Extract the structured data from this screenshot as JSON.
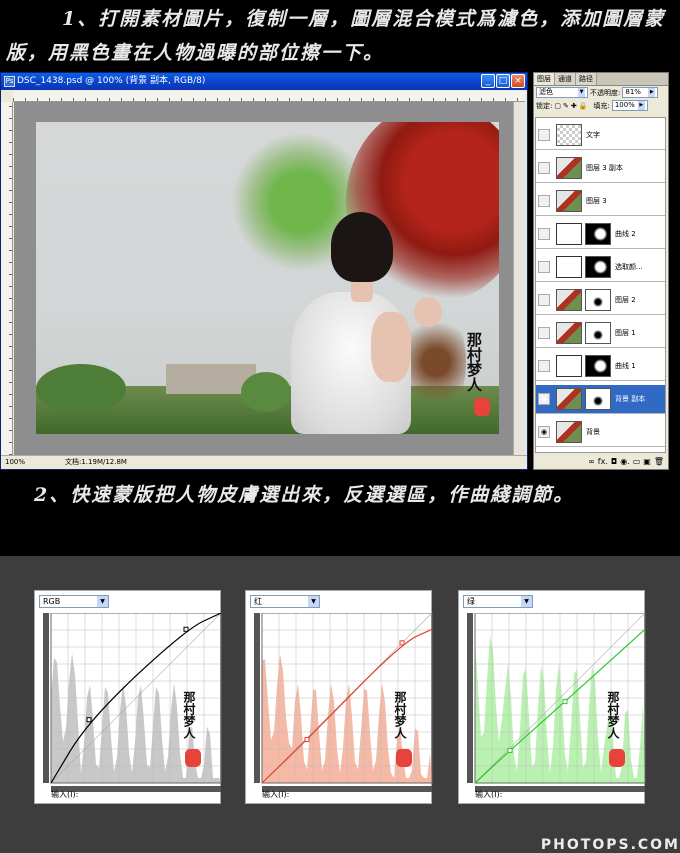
{
  "instructions": {
    "step1": "1、打開素材圖片，復制一層，圖層混合模式爲濾色，添加圖層蒙版，用黑色畫在人物過曝的部位擦一下。",
    "step2": "2、快速蒙版把人物皮膚選出來，反選選區，作曲綫調節。"
  },
  "document": {
    "title": "DSC_1438.psd @ 100% (背景 副本, RGB/8)",
    "zoom": "100%",
    "doc_size": "文档:1.19M/12.8M",
    "ps_icon": "Ps",
    "btn_min": "_",
    "btn_max": "□",
    "btn_close": "×",
    "calligraphy": "那村梦人"
  },
  "layers_panel": {
    "tabs": [
      "图层",
      "通道",
      "路径"
    ],
    "blend_mode": "滤色",
    "opacity_label": "不透明度:",
    "opacity_value": "81%",
    "lock_label": "锁定:",
    "fill_label": "填充:",
    "fill_value": "100%",
    "layers": [
      {
        "name": "文字",
        "thumb": "check",
        "mask": false,
        "visible": false,
        "selected": false
      },
      {
        "name": "图层 3 副本",
        "thumb": "photo",
        "mask": false,
        "visible": false,
        "selected": false
      },
      {
        "name": "图层 3",
        "thumb": "photo",
        "mask": false,
        "visible": false,
        "selected": false
      },
      {
        "name": "曲线 2",
        "thumb": "adj",
        "mask": true,
        "visible": false,
        "selected": false
      },
      {
        "name": "选取颜...",
        "thumb": "adj",
        "mask": true,
        "visible": false,
        "selected": false
      },
      {
        "name": "图层 2",
        "thumb": "photo",
        "mask": true,
        "visible": false,
        "selected": false
      },
      {
        "name": "图层 1",
        "thumb": "photo",
        "mask": true,
        "visible": false,
        "selected": false
      },
      {
        "name": "曲线 1",
        "thumb": "adj",
        "mask": true,
        "visible": false,
        "selected": false
      },
      {
        "name": "背景 副本",
        "thumb": "photo",
        "mask": true,
        "visible": true,
        "selected": true
      },
      {
        "name": "背景",
        "thumb": "photo",
        "mask": false,
        "visible": true,
        "selected": false
      }
    ],
    "footer_icons": [
      "∞",
      "fx.",
      "◘",
      "◉.",
      "▭",
      "▣",
      "🗑"
    ]
  },
  "curves": [
    {
      "channel": "RGB",
      "input_label": "输入(I):",
      "curve_color": "#000000",
      "hist_color": "#c8c8c8",
      "points": [
        [
          0,
          0
        ],
        [
          38,
          70
        ],
        [
          135,
          170
        ],
        [
          170,
          188
        ]
      ]
    },
    {
      "channel": "红",
      "input_label": "输入(I):",
      "curve_color": "#e0442a",
      "hist_color": "#f5b9a6",
      "points": [
        [
          0,
          0
        ],
        [
          45,
          48
        ],
        [
          140,
          155
        ],
        [
          170,
          170
        ]
      ]
    },
    {
      "channel": "绿",
      "input_label": "输入(I):",
      "curve_color": "#2ec72e",
      "hist_color": "#b9f1b0",
      "points": [
        [
          0,
          0
        ],
        [
          35,
          36
        ],
        [
          90,
          90
        ],
        [
          170,
          170
        ]
      ]
    }
  ],
  "colors": {
    "titlebar": "#0a46d0",
    "selected_layer": "#316ac5",
    "curves_bg": "#3d3d3d"
  },
  "watermark": "PHOTOPS.COM"
}
